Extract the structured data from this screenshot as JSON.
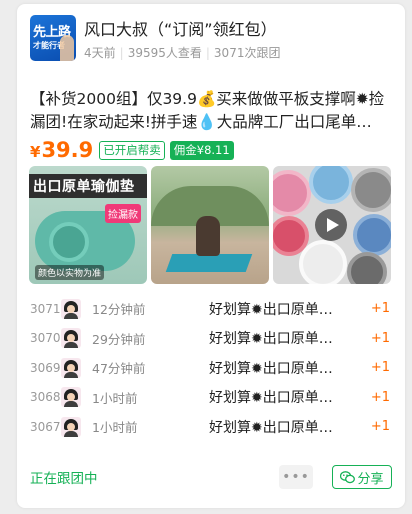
{
  "post": {
    "author_logo_text_1": "先上路",
    "author_logo_text_2": "才能行者",
    "author_name": "风口大叔（“订阅”领红包）",
    "time": "4天前",
    "views": "39595人查看",
    "followers": "3071次跟团"
  },
  "product": {
    "title": "【补货2000组】仅39.9💰买来做做平板支撑啊✹捡漏团!在家动起来!拼手速💧大品牌工厂出口尾单…",
    "currency": "¥",
    "price": "39.9",
    "tag_open": "已开启帮卖",
    "tag_commission": "佣金¥8.11"
  },
  "images": {
    "img1_banner": "出口原单瑜伽垫",
    "img1_badge": "捡漏款",
    "img1_small": "颜色以实物为准"
  },
  "orders": [
    {
      "num": "3071",
      "time": "12分钟前",
      "action": "好划算✹出口原单…",
      "plus": "+1"
    },
    {
      "num": "3070",
      "time": "29分钟前",
      "action": "好划算✹出口原单…",
      "plus": "+1"
    },
    {
      "num": "3069",
      "time": "47分钟前",
      "action": "好划算✹出口原单…",
      "plus": "+1"
    },
    {
      "num": "3068",
      "time": "1小时前",
      "action": "好划算✹出口原单…",
      "plus": "+1"
    },
    {
      "num": "3067",
      "time": "1小时前",
      "action": "好划算✹出口原单…",
      "plus": "+1"
    }
  ],
  "footer": {
    "status": "正在跟团中",
    "more": "•••",
    "share": "分享"
  },
  "colors": {
    "accent_green": "#16b156",
    "price_orange": "#ff6a00"
  }
}
